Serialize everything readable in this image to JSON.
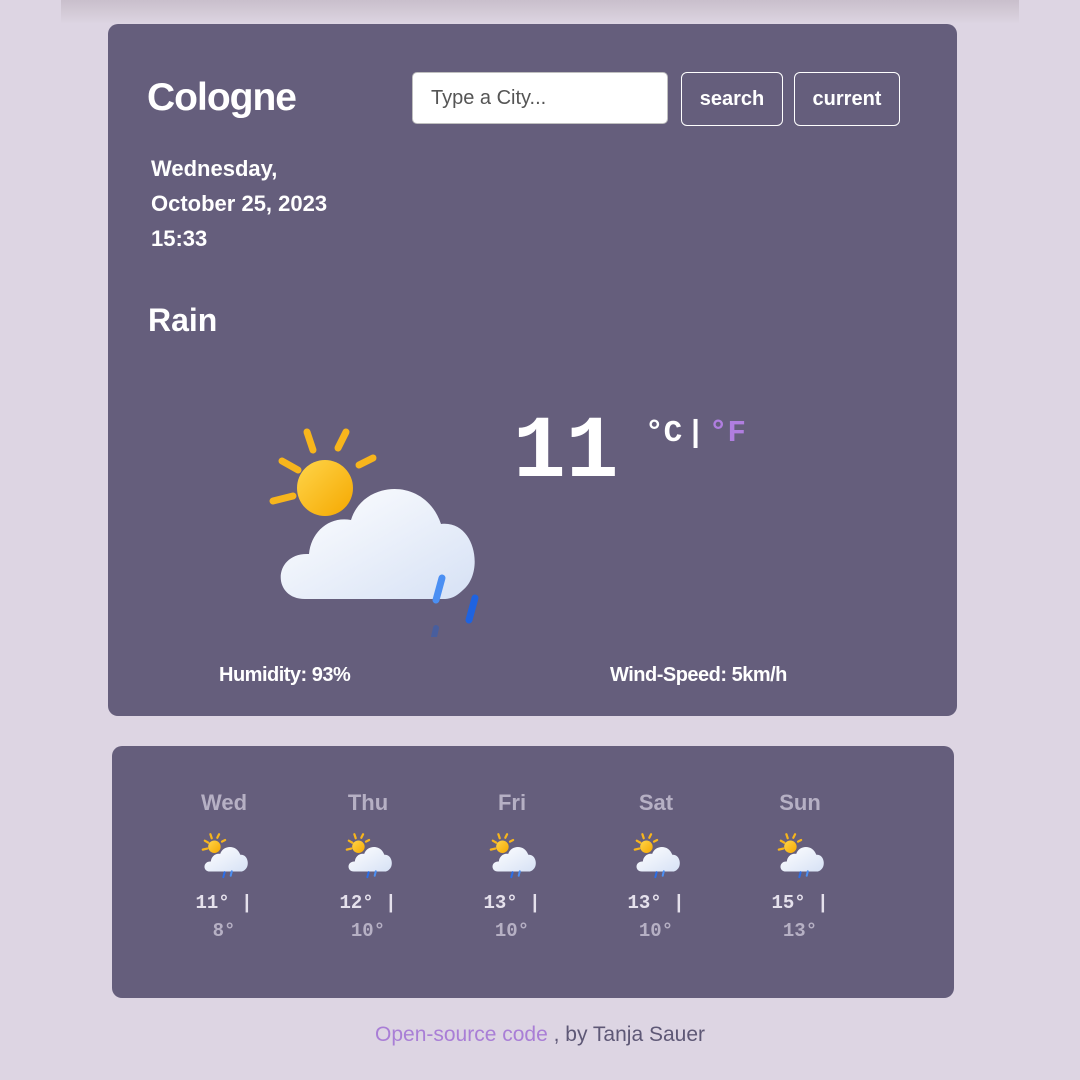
{
  "weather": {
    "city": "Cologne",
    "search": {
      "placeholder": "Type a City...",
      "search_label": "search",
      "current_label": "current"
    },
    "date_line1": "Wednesday,",
    "date_line2": "October 25, 2023",
    "time": "15:33",
    "condition": "Rain",
    "icon": "sun-cloud-rain-icon",
    "temperature": "11",
    "unit_celsius": "°C",
    "unit_separator": "|",
    "unit_fahrenheit": "°F",
    "humidity": "Humidity: 93%",
    "wind": "Wind-Speed: 5km/h"
  },
  "forecast": [
    {
      "day": "Wed",
      "max": "11° |",
      "min": "8°",
      "icon": "sun-cloud-rain-icon"
    },
    {
      "day": "Thu",
      "max": "12° |",
      "min": "10°",
      "icon": "sun-cloud-rain-icon"
    },
    {
      "day": "Fri",
      "max": "13° |",
      "min": "10°",
      "icon": "sun-cloud-rain-icon"
    },
    {
      "day": "Sat",
      "max": "13° |",
      "min": "10°",
      "icon": "sun-cloud-rain-icon"
    },
    {
      "day": "Sun",
      "max": "15° |",
      "min": "13°",
      "icon": "sun-cloud-rain-icon"
    }
  ],
  "footer": {
    "link_text": "Open-source code",
    "suffix": " , by Tanja Sauer"
  },
  "colors": {
    "card": "#655e7c",
    "background": "#ddd5e3",
    "accent": "#a97ed6"
  }
}
